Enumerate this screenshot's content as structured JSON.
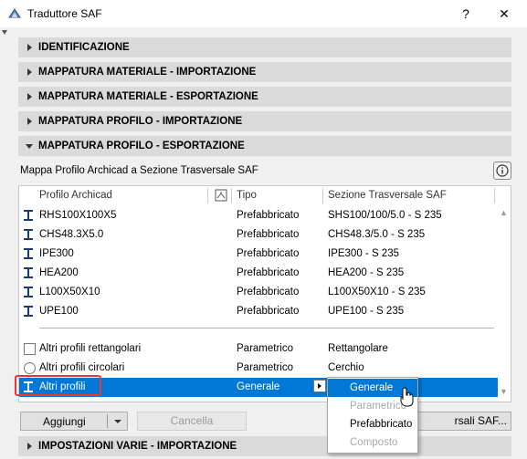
{
  "window": {
    "title": "Traduttore SAF",
    "help_label": "?",
    "close_label": "✕"
  },
  "sections": [
    {
      "label": "IDENTIFICAZIONE",
      "expanded": false
    },
    {
      "label": "MAPPATURA MATERIALE - IMPORTAZIONE",
      "expanded": false
    },
    {
      "label": "MAPPATURA MATERIALE - ESPORTAZIONE",
      "expanded": false
    },
    {
      "label": "MAPPATURA PROFILO - IMPORTAZIONE",
      "expanded": false
    },
    {
      "label": "MAPPATURA PROFILO - ESPORTAZIONE",
      "expanded": true
    }
  ],
  "bottom_section": {
    "label": "IMPOSTAZIONI VARIE - IMPORTAZIONE",
    "expanded": false
  },
  "mapping": {
    "description": "Mappa Profilo Archicad a Sezione Trasversale SAF",
    "columns": {
      "profile": "Profilo Archicad",
      "type": "Tipo",
      "section": "Sezione Trasversale SAF"
    },
    "rows": [
      {
        "icon": "i-beam-icon",
        "profile": "RHS100X100X5",
        "type": "Prefabbricato",
        "section": "SHS100/100/5.0 - S 235"
      },
      {
        "icon": "i-beam-icon",
        "profile": "CHS48.3X5.0",
        "type": "Prefabbricato",
        "section": "CHS48.3/5.0 - S 235"
      },
      {
        "icon": "i-beam-icon",
        "profile": "IPE300",
        "type": "Prefabbricato",
        "section": "IPE300 - S 235"
      },
      {
        "icon": "i-beam-icon",
        "profile": "HEA200",
        "type": "Prefabbricato",
        "section": "HEA200 - S 235"
      },
      {
        "icon": "i-beam-icon",
        "profile": "L100X50X10",
        "type": "Prefabbricato",
        "section": "L100X50X10 - S 235"
      },
      {
        "icon": "i-beam-icon",
        "profile": "UPE100",
        "type": "Prefabbricato",
        "section": "UPE100 - S 235"
      }
    ],
    "generic_rows": [
      {
        "icon": "rectangle-icon",
        "profile": "Altri profili rettangolari",
        "type": "Parametrico",
        "section": "Rettangolare"
      },
      {
        "icon": "circle-icon",
        "profile": "Altri profili circolari",
        "type": "Parametrico",
        "section": "Cerchio"
      }
    ],
    "selected_row": {
      "icon": "i-beam-icon",
      "profile": "Altri profili",
      "type": "Generale"
    }
  },
  "type_dropdown": {
    "options": [
      {
        "label": "Generale",
        "state": "highlighted"
      },
      {
        "label": "Parametrico",
        "state": "disabled"
      },
      {
        "label": "Prefabbricato",
        "state": "enabled"
      },
      {
        "label": "Composto",
        "state": "disabled"
      }
    ]
  },
  "buttons": {
    "add": "Aggiungi",
    "cancel": "Cancella",
    "saf_sections": "rsali SAF..."
  },
  "colors": {
    "selection": "#0078d7",
    "highlight_box": "#e53935",
    "section_bg": "#dadada"
  }
}
